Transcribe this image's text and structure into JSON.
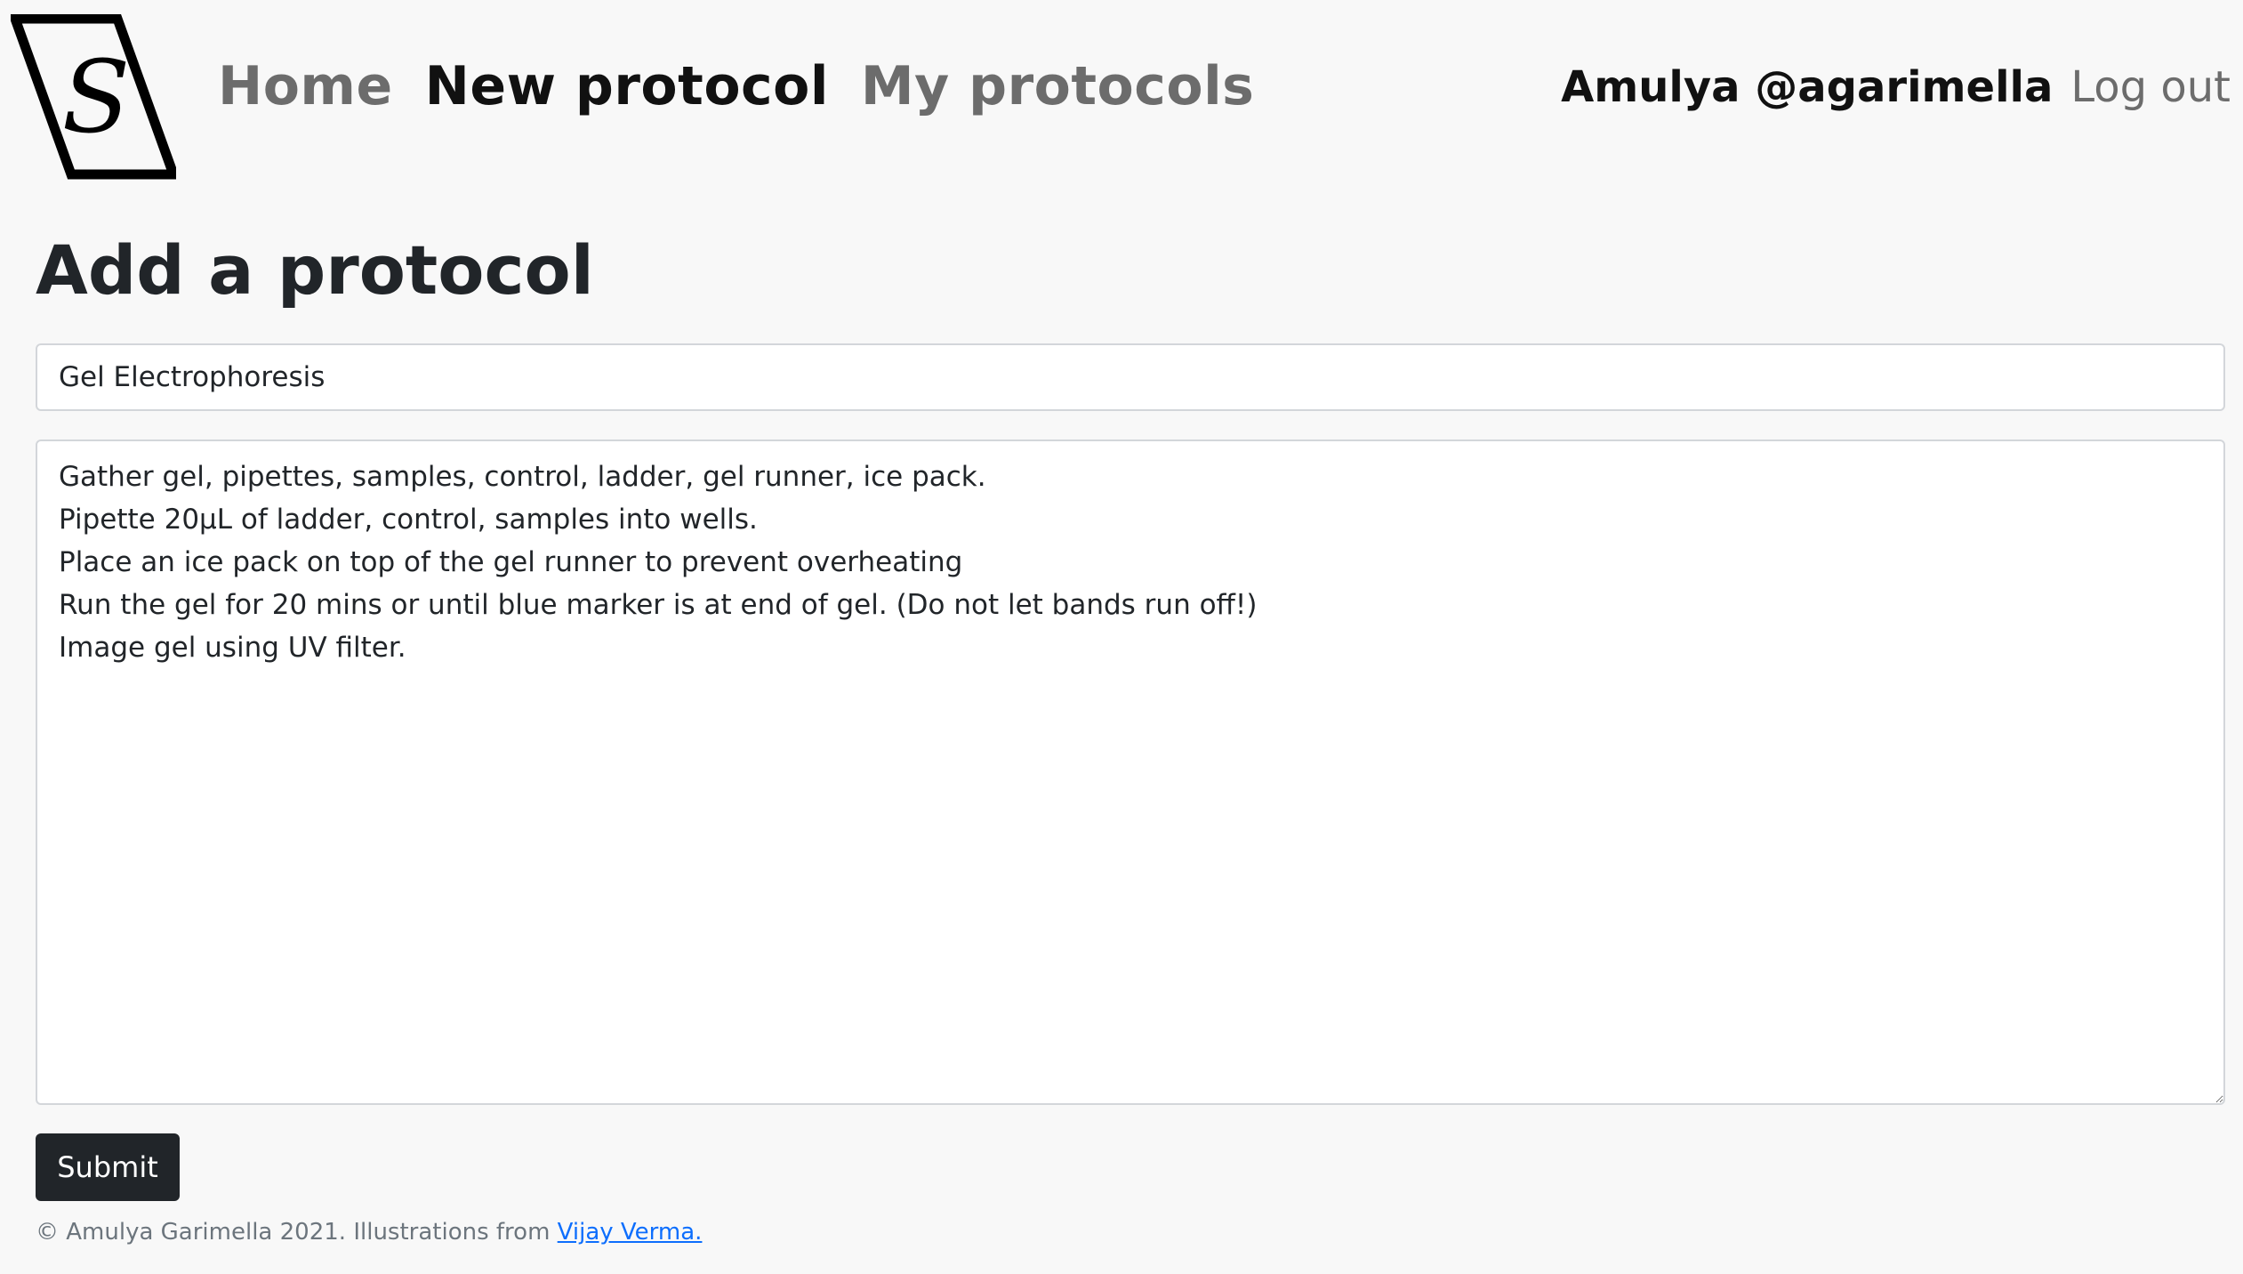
{
  "logo": {
    "letter": "S",
    "icon": "s-logo-icon"
  },
  "nav": {
    "items": [
      {
        "label": "Home",
        "active": false
      },
      {
        "label": "New protocol",
        "active": true
      },
      {
        "label": "My protocols",
        "active": false
      }
    ]
  },
  "user": {
    "display": "Amulya @agarimella",
    "logout_label": "Log out"
  },
  "page": {
    "title": "Add a protocol"
  },
  "form": {
    "title_value": "Gel Electrophoresis",
    "body_value": "Gather gel, pipettes, samples, control, ladder, gel runner, ice pack.\nPipette 20µL of ladder, control, samples into wells.\nPlace an ice pack on top of the gel runner to prevent overheating\nRun the gel for 20 mins or until blue marker is at end of gel. (Do not let bands run off!)\nImage gel using UV filter.",
    "submit_label": "Submit"
  },
  "footer": {
    "text": "© Amulya Garimella 2021. Illustrations from ",
    "link_label": "Vijay Verma."
  },
  "colors": {
    "background": "#f8f8f8",
    "text_dark": "#212529",
    "nav_muted": "#6c6c6c",
    "button_bg": "#212529",
    "link": "#0d6efd"
  }
}
